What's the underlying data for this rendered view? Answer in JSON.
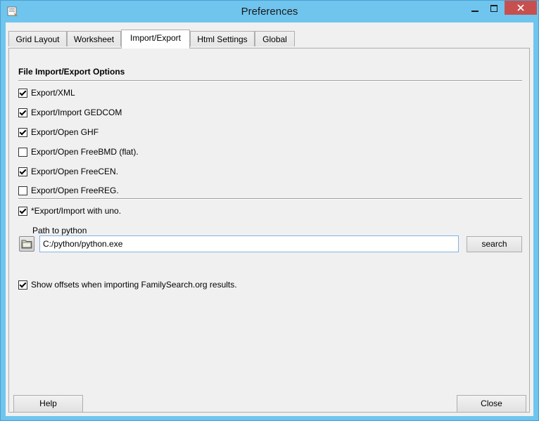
{
  "window": {
    "title": "Preferences",
    "icon": "app-icon",
    "buttons": {
      "minimize": "minimize-icon",
      "maximize": "maximize-icon",
      "close": "close-icon"
    }
  },
  "tabs": [
    {
      "label": "Grid Layout"
    },
    {
      "label": "Worksheet"
    },
    {
      "label": "Import/Export",
      "active": true
    },
    {
      "label": "Html Settings"
    },
    {
      "label": "Global"
    }
  ],
  "section": {
    "title": "File Import/Export Options"
  },
  "options": [
    {
      "label": "Export/XML",
      "checked": true
    },
    {
      "label": "Export/Import GEDCOM",
      "checked": true
    },
    {
      "label": "Export/Open GHF",
      "checked": true
    },
    {
      "label": "Export/Open FreeBMD (flat).",
      "checked": false
    },
    {
      "label": "Export/Open FreeCEN.",
      "checked": true
    },
    {
      "label": "Export/Open FreeREG.",
      "checked": false
    }
  ],
  "uno": {
    "label": "*Export/Import with uno.",
    "checked": true
  },
  "python": {
    "label": "Path to python",
    "value": "C:/python/python.exe",
    "search_label": "search"
  },
  "offsets": {
    "label": "Show offsets when importing FamilySearch.org results.",
    "checked": true
  },
  "footer": {
    "help_label": "Help",
    "close_label": "Close"
  },
  "colors": {
    "titlebar": "#6fc5ee",
    "close_button": "#c7504f",
    "input_border": "#7eb4ea"
  }
}
